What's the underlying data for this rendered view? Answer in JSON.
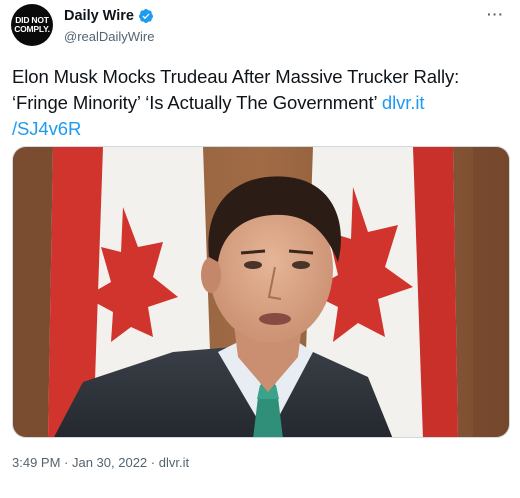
{
  "account": {
    "avatar_text_line1": "DID NOT",
    "avatar_text_line2": "COMPLY.",
    "display_name": "Daily Wire",
    "handle": "@realDailyWire",
    "verified_icon": "verified-badge-icon",
    "more_label": "···"
  },
  "tweet": {
    "text_main": "Elon Musk Mocks Trudeau After Massive Trucker Rally: ‘Fringe Minority’ ‘Is Actually The Government’ ",
    "link_text": "dlvr.it /SJ4v6R",
    "link_part1": "dlvr.it",
    "link_part2": "/SJ4v6R"
  },
  "meta": {
    "time": "3:49 PM",
    "separator": " · ",
    "date": "Jan 30, 2022",
    "source": "dlvr.it"
  },
  "colors": {
    "link": "#1d9bf0",
    "verified": "#1d9bf0",
    "secondary_text": "#536471",
    "flag_red": "#d0342c"
  },
  "media": {
    "description_icon": "photo-image"
  }
}
